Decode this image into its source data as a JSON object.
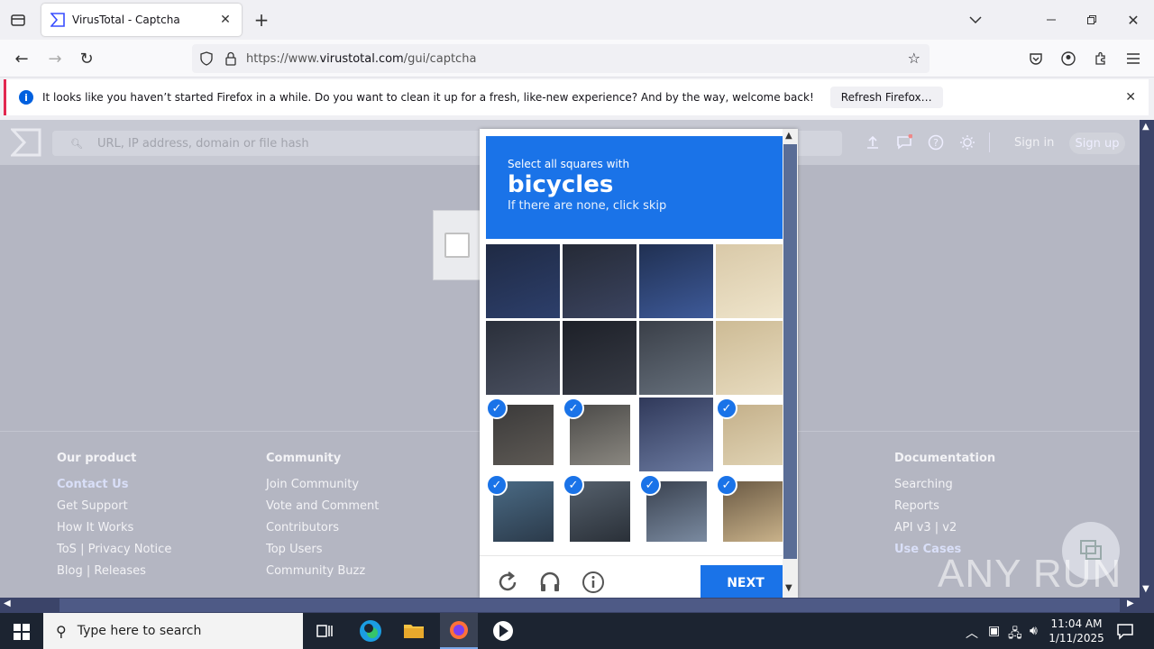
{
  "browser": {
    "tab_title": "VirusTotal - Captcha",
    "url_prefix": "https://www.",
    "url_domain": "virustotal.com",
    "url_path": "/gui/captcha",
    "notification": {
      "message": "It looks like you haven’t started Firefox in a while. Do you want to clean it up for a fresh, like-new experience? And by the way, welcome back!",
      "button": "Refresh Firefox…"
    }
  },
  "vt": {
    "search_placeholder": "URL, IP address, domain or file hash",
    "signin": "Sign in",
    "signup": "Sign up",
    "footer": {
      "our_product": {
        "heading": "Our product",
        "links": [
          "Contact Us",
          "Get Support",
          "How It Works",
          "ToS | Privacy Notice",
          "Blog | Releases"
        ]
      },
      "community": {
        "heading": "Community",
        "links": [
          "Join Community",
          "Vote and Comment",
          "Contributors",
          "Top Users",
          "Community Buzz"
        ]
      },
      "documentation": {
        "heading": "Documentation",
        "links": [
          "Searching",
          "Reports",
          "API v3 | v2",
          "Use Cases"
        ]
      }
    }
  },
  "captcha": {
    "instruction": "Select all squares with",
    "target": "bicycles",
    "hint": "If there are none, click skip",
    "next": "NEXT",
    "selected_tiles": [
      8,
      9,
      11,
      12,
      13,
      14,
      15
    ]
  },
  "watermark": "ANY RUN",
  "taskbar": {
    "search_placeholder": "Type here to search",
    "time": "11:04 AM",
    "date": "1/11/2025"
  },
  "colors": {
    "accent": "#1a73e8",
    "page_overlay": "#b4b6c2",
    "taskbar": "#1c2431"
  }
}
